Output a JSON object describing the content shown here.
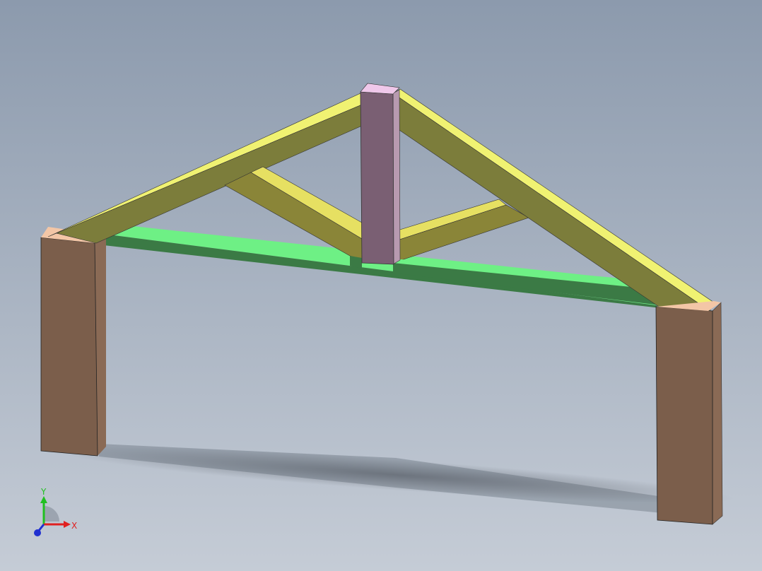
{
  "viewport": {
    "background_top": "#8c9aad",
    "background_bottom": "#c5ccd6"
  },
  "model": {
    "colors": {
      "post_front": "#7b5e4b",
      "post_side": "#8a6a55",
      "post_top": "#f3c6a6",
      "rafter_top": "#f0f272",
      "rafter_side": "#7c7d3b",
      "web_top": "#e6e062",
      "web_side": "#8a8538",
      "tie_top": "#6ef085",
      "tie_side": "#3b7a45",
      "king_post_front": "#7a5f73",
      "king_post_side": "#b89ab0",
      "king_post_top": "#efc8ea"
    }
  },
  "triad": {
    "x_label": "X",
    "y_label": "Y",
    "x_color": "#e02020",
    "y_color": "#20c020",
    "z_color": "#2030d0"
  }
}
